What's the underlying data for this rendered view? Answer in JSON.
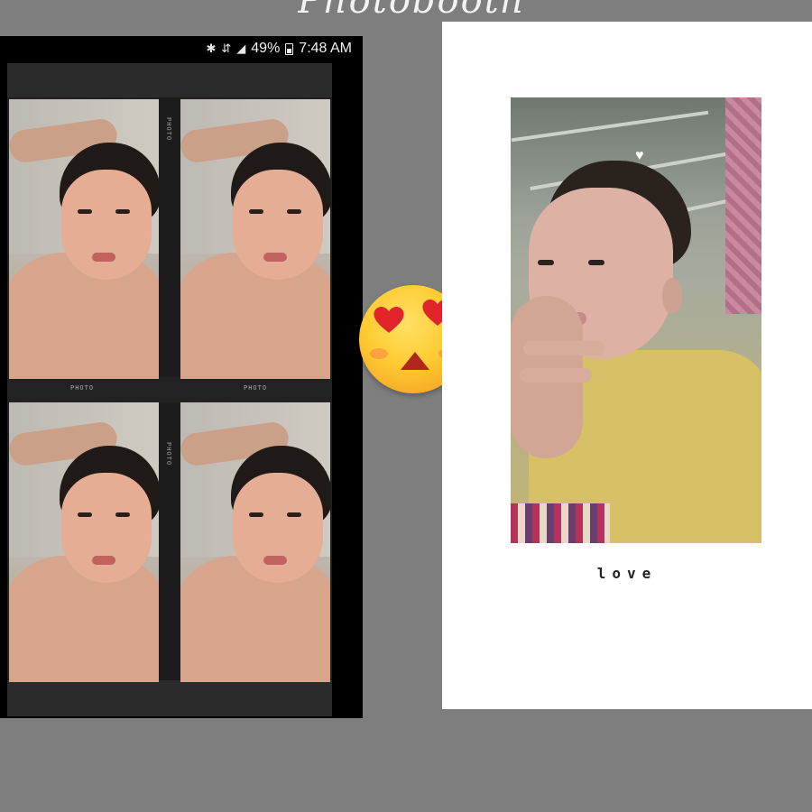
{
  "header": {
    "title": "Photobooth"
  },
  "status_bar": {
    "battery": "49%",
    "time": "7:48 AM"
  },
  "film_strip": {
    "label": "PHOTO",
    "frame_count": 4
  },
  "emoji": {
    "name": "heart-eyes-emoji"
  },
  "card": {
    "caption": "love"
  }
}
